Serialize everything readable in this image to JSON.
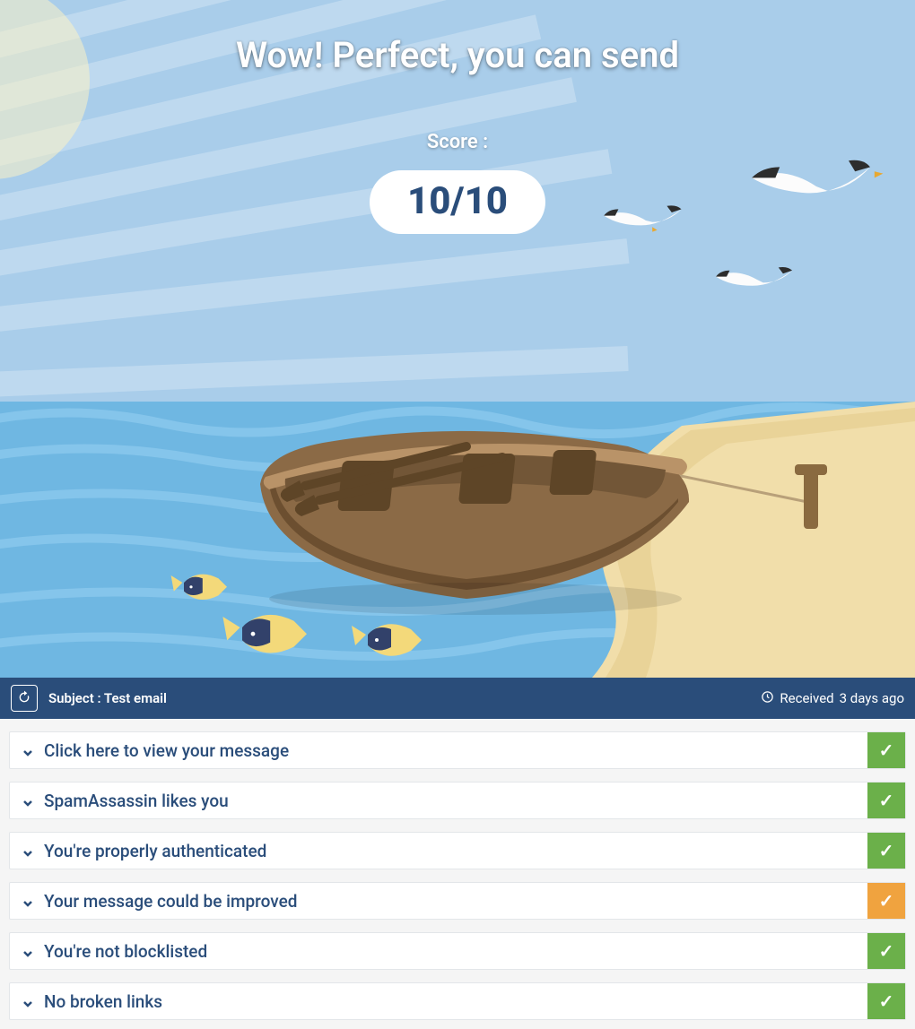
{
  "hero": {
    "title": "Wow! Perfect, you can send",
    "score_label": "Score :",
    "score_value": "10/10"
  },
  "subject_bar": {
    "subject_prefix": "Subject : ",
    "subject_value": "Test email",
    "received_prefix": "Received ",
    "received_value": "3 days ago"
  },
  "accordion": [
    {
      "title": "Click here to view your message",
      "status": "ok"
    },
    {
      "title": "SpamAssassin likes you",
      "status": "ok"
    },
    {
      "title": "You're properly authenticated",
      "status": "ok"
    },
    {
      "title": "Your message could be improved",
      "status": "warn"
    },
    {
      "title": "You're not blocklisted",
      "status": "ok"
    },
    {
      "title": "No broken links",
      "status": "ok"
    }
  ],
  "icons": {
    "check": "✓"
  },
  "colors": {
    "brand_dark": "#2a4d7a",
    "status_ok": "#6bb04a",
    "status_warn": "#f0a33f",
    "sky": "#a9cdea",
    "sea": "#6fb7e2",
    "sand": "#f1deaa"
  }
}
